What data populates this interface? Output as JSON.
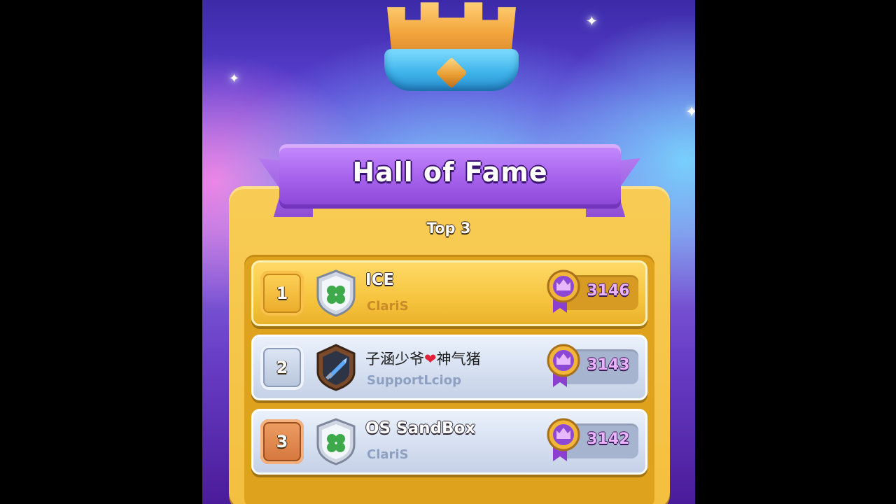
{
  "colors": {
    "ribbon": "#a764ec",
    "panel": "#f3bf3f",
    "gold_row": "#f6c43e",
    "silver_row": "#d4def0",
    "score_text": "#e9b3ff"
  },
  "header": {
    "title": "Hall of Fame",
    "subtitle": "Top 3"
  },
  "leaderboard": [
    {
      "rank": "1",
      "name": "ICE",
      "clan": "ClariS",
      "score": "3146",
      "clan_badge_icon": "clover-shield-icon",
      "style": "gold"
    },
    {
      "rank": "2",
      "name_part1": "子涵少爷",
      "name_heart": "❤",
      "name_part2": "神气猪",
      "clan": "SupportLciop",
      "score": "3143",
      "clan_badge_icon": "sword-shield-icon",
      "style": "silver"
    },
    {
      "rank": "3",
      "name": "OS SandBox",
      "clan": "ClariS",
      "score": "3142",
      "clan_badge_icon": "clover-shield-icon",
      "style": "silver"
    }
  ]
}
